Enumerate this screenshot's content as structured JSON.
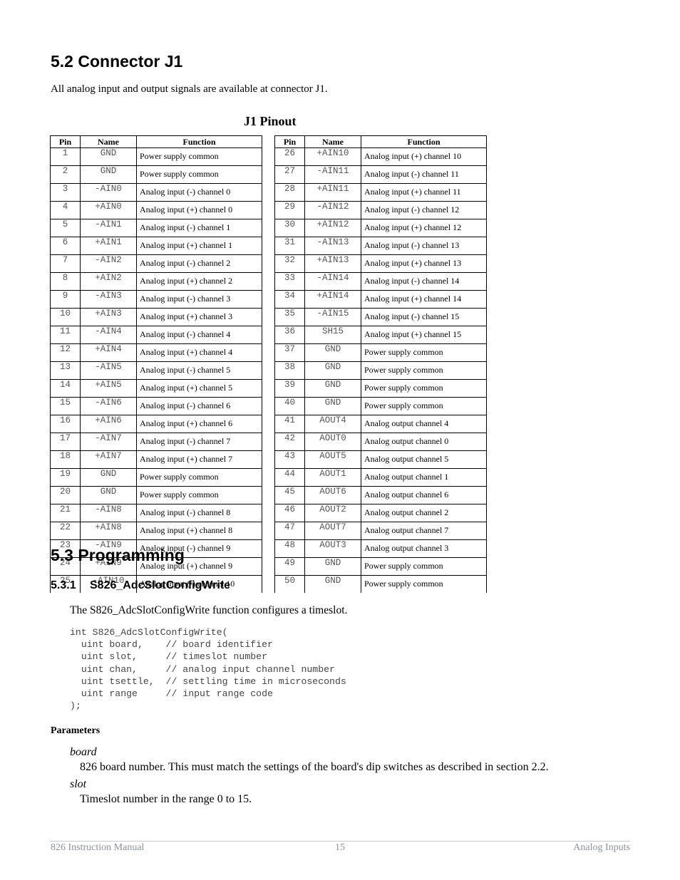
{
  "section_52": {
    "heading": "5.2  Connector J1",
    "intro": "All analog input and output signals are available at connector J1.",
    "table_caption": "J1 Pinout",
    "columns": [
      "Pin",
      "Name",
      "Function"
    ],
    "left_rows": [
      {
        "pin": "1",
        "name": "GND",
        "function": "Power supply common"
      },
      {
        "pin": "2",
        "name": "GND",
        "function": "Power supply common"
      },
      {
        "pin": "3",
        "name": "-AIN0",
        "function": "Analog input (-) channel 0"
      },
      {
        "pin": "4",
        "name": "+AIN0",
        "function": "Analog input (+) channel 0"
      },
      {
        "pin": "5",
        "name": "-AIN1",
        "function": "Analog input (-) channel 1"
      },
      {
        "pin": "6",
        "name": "+AIN1",
        "function": "Analog input (+) channel 1"
      },
      {
        "pin": "7",
        "name": "-AIN2",
        "function": "Analog input (-) channel 2"
      },
      {
        "pin": "8",
        "name": "+AIN2",
        "function": "Analog input (+) channel 2"
      },
      {
        "pin": "9",
        "name": "-AIN3",
        "function": "Analog input (-) channel 3"
      },
      {
        "pin": "10",
        "name": "+AIN3",
        "function": "Analog input (+) channel 3"
      },
      {
        "pin": "11",
        "name": "-AIN4",
        "function": "Analog input (-) channel 4"
      },
      {
        "pin": "12",
        "name": "+AIN4",
        "function": "Analog input (+) channel 4"
      },
      {
        "pin": "13",
        "name": "-AIN5",
        "function": "Analog input (-) channel 5"
      },
      {
        "pin": "14",
        "name": "+AIN5",
        "function": "Analog input (+) channel 5"
      },
      {
        "pin": "15",
        "name": "-AIN6",
        "function": "Analog input (-) channel 6"
      },
      {
        "pin": "16",
        "name": "+AIN6",
        "function": "Analog input (+) channel 6"
      },
      {
        "pin": "17",
        "name": "-AIN7",
        "function": "Analog input (-) channel 7"
      },
      {
        "pin": "18",
        "name": "+AIN7",
        "function": "Analog input (+) channel 7"
      },
      {
        "pin": "19",
        "name": "GND",
        "function": "Power supply common"
      },
      {
        "pin": "20",
        "name": "GND",
        "function": "Power supply common"
      },
      {
        "pin": "21",
        "name": "-AIN8",
        "function": "Analog input (-) channel 8"
      },
      {
        "pin": "22",
        "name": "+AIN8",
        "function": "Analog input (+) channel 8"
      },
      {
        "pin": "23",
        "name": "-AIN9",
        "function": "Analog input (-) channel 9"
      },
      {
        "pin": "24",
        "name": "+AIN9",
        "function": "Analog input (+) channel 9"
      },
      {
        "pin": "25",
        "name": "-AIN10",
        "function": "Analog input (-) channel 10"
      }
    ],
    "right_rows": [
      {
        "pin": "26",
        "name": "+AIN10",
        "function": "Analog input (+) channel 10"
      },
      {
        "pin": "27",
        "name": "-AIN11",
        "function": "Analog input (-) channel 11"
      },
      {
        "pin": "28",
        "name": "+AIN11",
        "function": "Analog input (+) channel 11"
      },
      {
        "pin": "29",
        "name": "-AIN12",
        "function": "Analog input (-) channel 12"
      },
      {
        "pin": "30",
        "name": "+AIN12",
        "function": "Analog input (+) channel 12"
      },
      {
        "pin": "31",
        "name": "-AIN13",
        "function": "Analog input (-) channel 13"
      },
      {
        "pin": "32",
        "name": "+AIN13",
        "function": "Analog input (+) channel 13"
      },
      {
        "pin": "33",
        "name": "-AIN14",
        "function": "Analog input (-) channel 14"
      },
      {
        "pin": "34",
        "name": "+AIN14",
        "function": "Analog input (+) channel 14"
      },
      {
        "pin": "35",
        "name": "-AIN15",
        "function": "Analog input (-) channel 15"
      },
      {
        "pin": "36",
        "name": "SH15",
        "function": "Analog input (+) channel 15"
      },
      {
        "pin": "37",
        "name": "GND",
        "function": "Power supply common"
      },
      {
        "pin": "38",
        "name": "GND",
        "function": "Power supply common"
      },
      {
        "pin": "39",
        "name": "GND",
        "function": "Power supply common"
      },
      {
        "pin": "40",
        "name": "GND",
        "function": "Power supply common"
      },
      {
        "pin": "41",
        "name": "AOUT4",
        "function": "Analog output channel 4"
      },
      {
        "pin": "42",
        "name": "AOUT0",
        "function": "Analog output channel 0"
      },
      {
        "pin": "43",
        "name": "AOUT5",
        "function": "Analog output channel 5"
      },
      {
        "pin": "44",
        "name": "AOUT1",
        "function": "Analog output channel 1"
      },
      {
        "pin": "45",
        "name": "AOUT6",
        "function": "Analog output channel 6"
      },
      {
        "pin": "46",
        "name": "AOUT2",
        "function": "Analog output channel 2"
      },
      {
        "pin": "47",
        "name": "AOUT7",
        "function": "Analog output channel 7"
      },
      {
        "pin": "48",
        "name": "AOUT3",
        "function": "Analog output channel 3"
      },
      {
        "pin": "49",
        "name": "GND",
        "function": "Power supply common"
      },
      {
        "pin": "50",
        "name": "GND",
        "function": "Power supply common"
      }
    ]
  },
  "section_53": {
    "heading": "5.3  Programming",
    "sub_number": "5.3.1",
    "sub_title": "S826_AdcSlotConfigWrite",
    "description": "The S826_AdcSlotConfigWrite function configures a timeslot.",
    "code_lines": [
      "int S826_AdcSlotConfigWrite(",
      "  uint board,    // board identifier",
      "  uint slot,     // timeslot number",
      "  uint chan,     // analog input channel number",
      "  uint tsettle,  // settling time in microseconds",
      "  uint range     // input range code",
      ");"
    ],
    "parameters_label": "Parameters",
    "parameters": [
      {
        "name": "board",
        "description": "826 board number. This must match the settings of the board's dip switches as described in section 2.2."
      },
      {
        "name": "slot",
        "description": "Timeslot number in the range 0 to 15."
      }
    ]
  },
  "footer": {
    "left": "826 Instruction Manual",
    "center": "15",
    "right": "Analog Inputs"
  }
}
